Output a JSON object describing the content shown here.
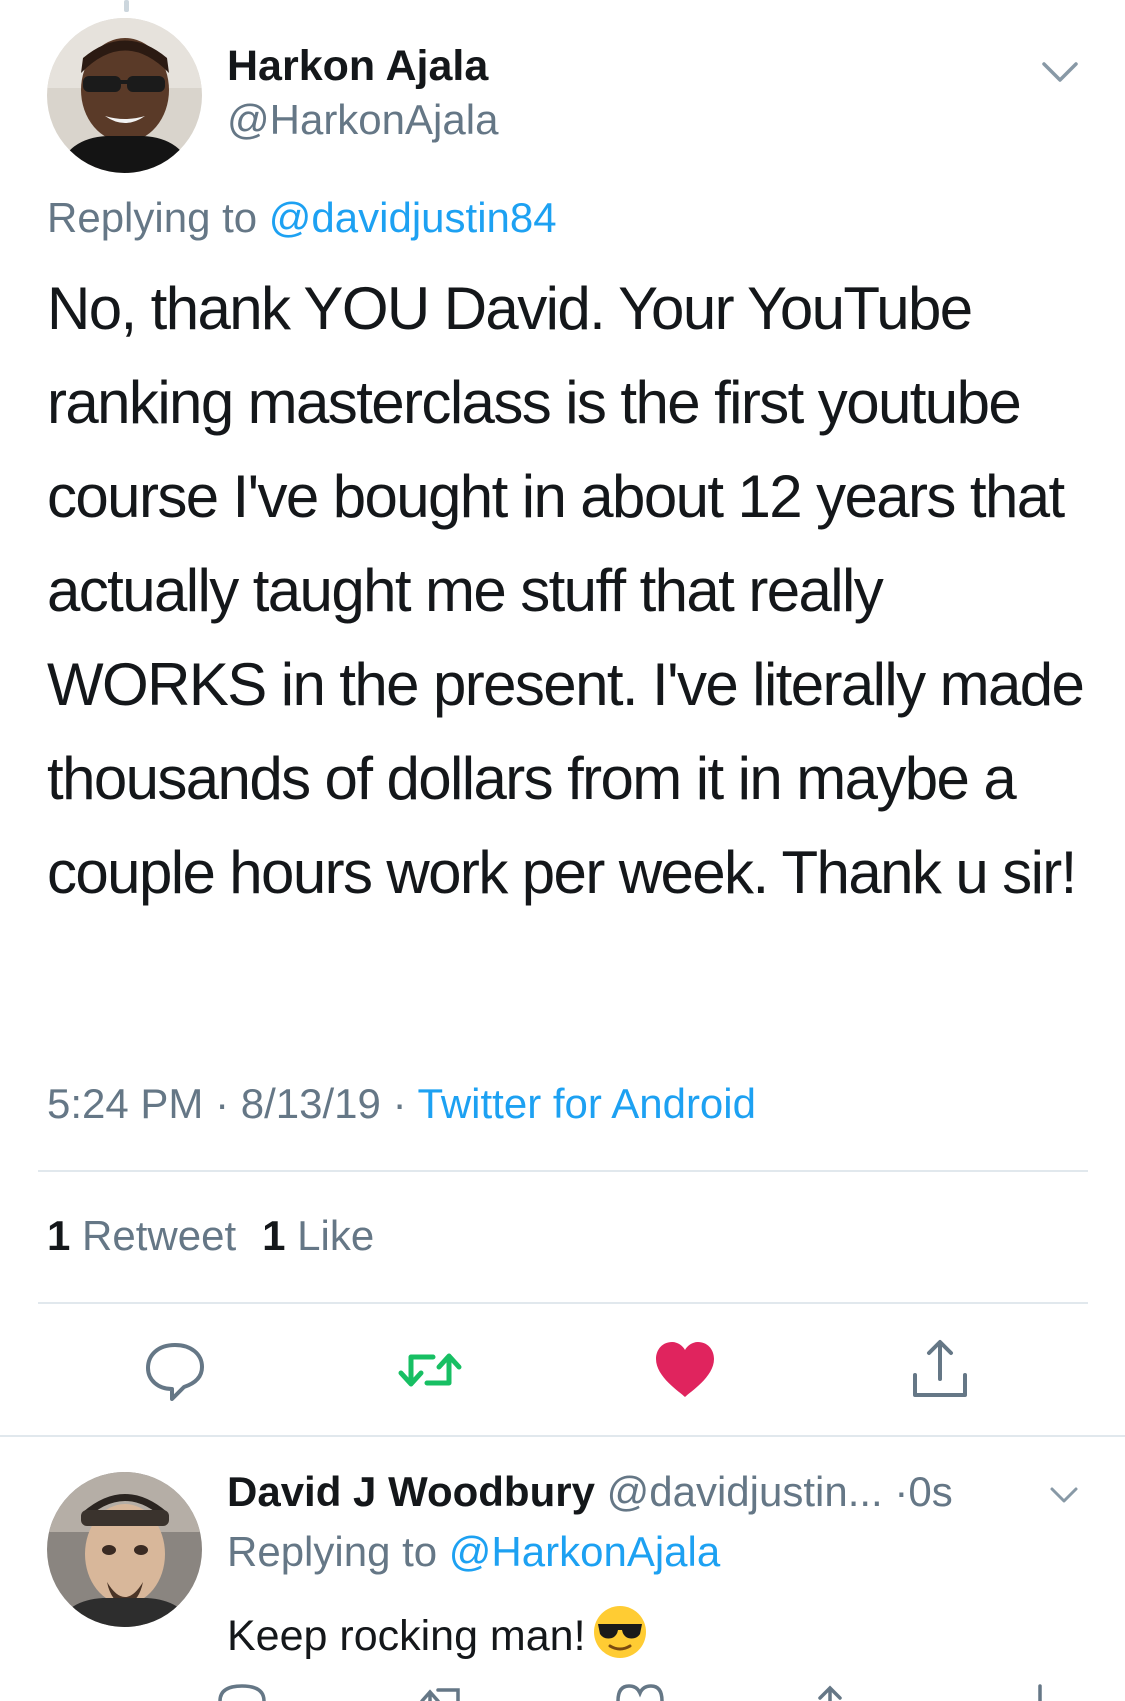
{
  "tweet": {
    "author_name": "Harkon Ajala",
    "author_handle": "@HarkonAjala",
    "replying_prefix": "Replying to",
    "replying_to": "@davidjustin84",
    "text": "No, thank YOU David.  Your YouTube ranking masterclass is the first youtube course I've bought in about 12 years that actually taught me stuff that really WORKS in the present. I've literally made thousands of dollars from it in maybe a couple hours work per week.  Thank u sir!",
    "time": "5:24 PM",
    "date": "8/13/19",
    "separator": "·",
    "source": "Twitter for Android",
    "retweet_count": "1",
    "retweet_label": "Retweet",
    "like_count": "1",
    "like_label": "Like"
  },
  "actions": {
    "reply_icon": "speech-bubble-icon",
    "retweet_icon": "retweet-arrows-icon",
    "like_icon": "heart-icon",
    "share_icon": "share-upload-icon",
    "retweet_color": "#17bf63",
    "like_color": "#e0245e",
    "icon_color": "#657786"
  },
  "reply": {
    "author_name": "David J Woodbury",
    "author_handle": "@davidjustin...",
    "time_sep": "·",
    "time": "0s",
    "replying_prefix": "Replying to",
    "replying_to": "@HarkonAjala",
    "text": "Keep rocking man!",
    "emoji": "sunglasses-face-emoji"
  },
  "colors": {
    "link": "#1da1f2",
    "secondary": "#657786",
    "divider": "#e1e8ed",
    "text": "#14171a"
  }
}
